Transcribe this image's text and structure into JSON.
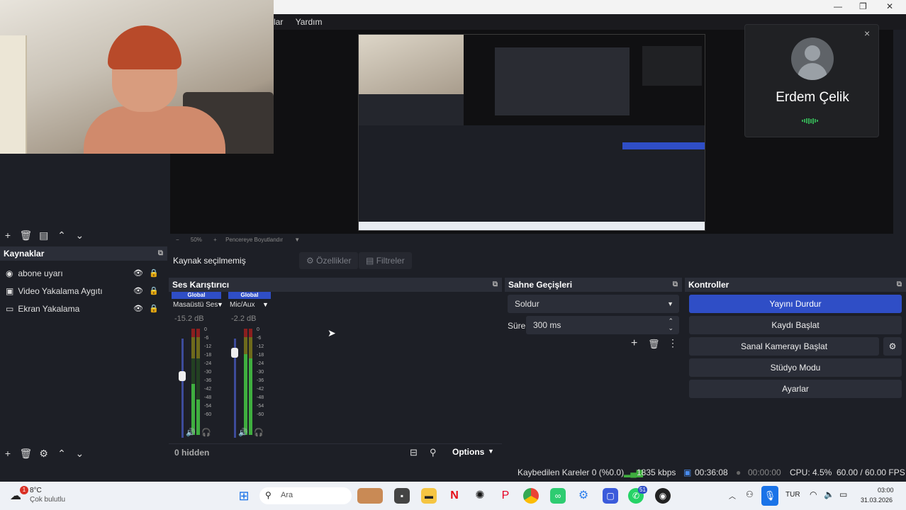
{
  "menu": {
    "items": [
      "lar",
      "Yardım"
    ]
  },
  "call": {
    "name": "Erdem Çelik",
    "close": "×"
  },
  "preview": {
    "zoom": "50%",
    "resize_label": "Pencereye Boyutlandır"
  },
  "source_bar": {
    "status": "Kaynak seçilmemiş",
    "properties": "Özellikler",
    "filters": "Filtreler"
  },
  "sources": {
    "title": "Kaynaklar",
    "items": [
      {
        "label": "abone uyarı",
        "icon": "browser-icon"
      },
      {
        "label": "Video Yakalama Aygıtı",
        "icon": "camera-icon"
      },
      {
        "label": "Ekran Yakalama",
        "icon": "monitor-icon"
      }
    ]
  },
  "mixer": {
    "title": "Ses Karıştırıcı",
    "channels": [
      {
        "badge": "Global",
        "name": "Masaüstü Ses",
        "db": "-15.2 dB",
        "fader": 0.62
      },
      {
        "badge": "Global",
        "name": "Mic/Aux",
        "db": "-2.2 dB",
        "fader": 0.86
      }
    ],
    "scale": [
      "0",
      "-6",
      "-12",
      "-18",
      "-24",
      "-30",
      "-36",
      "-42",
      "-48",
      "-54",
      "-60"
    ],
    "hidden": "0 hidden",
    "options": "Options"
  },
  "transitions": {
    "title": "Sahne Geçişleri",
    "selected": "Soldur",
    "duration_label": "Süre",
    "duration_value": "300 ms"
  },
  "controls": {
    "title": "Kontroller",
    "buttons": [
      "Yayını Durdur",
      "Kaydı Başlat",
      "Sanal Kamerayı Başlat",
      "Stüdyo Modu",
      "Ayarlar"
    ]
  },
  "status": {
    "dropped": "Kaybedilen Kareler 0 (%0.0)",
    "bitrate": "1835 kbps",
    "stream_time": "00:36:08",
    "rec_time": "00:00:00",
    "cpu": "CPU: 4.5%",
    "fps": "60.00 / 60.00 FPS"
  },
  "taskbar": {
    "weather_temp": "8°C",
    "weather_desc": "Çok bulutlu",
    "weather_badge": "1",
    "search": "Ara",
    "lang": "TUR",
    "time": "03:00",
    "date": "31.03.2026",
    "whatsapp_badge": "51"
  },
  "colors": {
    "accent": "#2f4ec6",
    "panel": "#1d1f26",
    "header": "#2b2e38"
  }
}
